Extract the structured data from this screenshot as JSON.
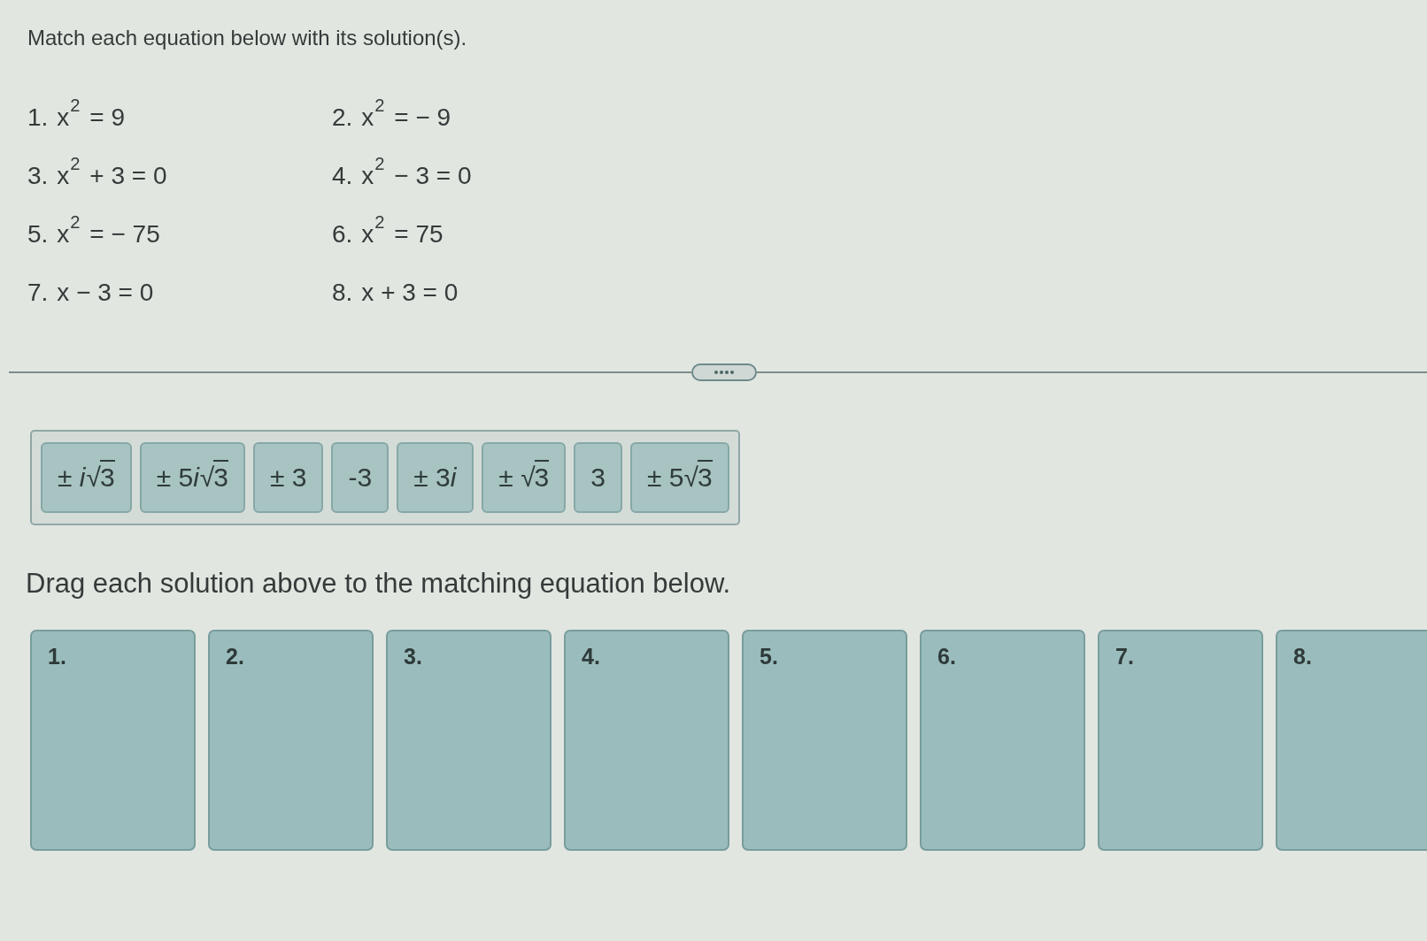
{
  "instructions": "Match each equation below with its solution(s).",
  "equations": [
    {
      "number": "1.",
      "equation": "x$^{2}$ = 9"
    },
    {
      "number": "2.",
      "equation": "x$^{2}$ = − 9"
    },
    {
      "number": "3.",
      "equation": "x$^{2}$ + 3 = 0"
    },
    {
      "number": "4.",
      "equation": "x$^{2}$ − 3 = 0"
    },
    {
      "number": "5.",
      "equation": "x$^{2}$ = − 75"
    },
    {
      "number": "6.",
      "equation": "x$^{2}$ = 75"
    },
    {
      "number": "7.",
      "equation": "x − 3 = 0"
    },
    {
      "number": "8.",
      "equation": "x + 3 = 0"
    }
  ],
  "solutions": [
    {
      "sign": "±",
      "imaginary_unit": "i",
      "radical": "√",
      "radicand": "3"
    },
    {
      "sign": "±",
      "coefficient": "5",
      "imaginary_unit": "i",
      "radical": "√",
      "radicand": "3"
    },
    {
      "sign": "±",
      "coefficient": "3"
    },
    {
      "coefficient": "-3"
    },
    {
      "sign": "±",
      "coefficient": "3",
      "imaginary_unit": "i"
    },
    {
      "sign": "±",
      "radical": "√",
      "radicand": "3"
    },
    {
      "coefficient": "3"
    },
    {
      "sign": "±",
      "coefficient": "5",
      "radical": "√",
      "radicand": "3"
    }
  ],
  "drag_instructions": "Drag each solution above to the matching equation below.",
  "drop_zones": [
    {
      "label": "1."
    },
    {
      "label": "2."
    },
    {
      "label": "3."
    },
    {
      "label": "4."
    },
    {
      "label": "5."
    },
    {
      "label": "6."
    },
    {
      "label": "7."
    },
    {
      "label": "8."
    }
  ]
}
